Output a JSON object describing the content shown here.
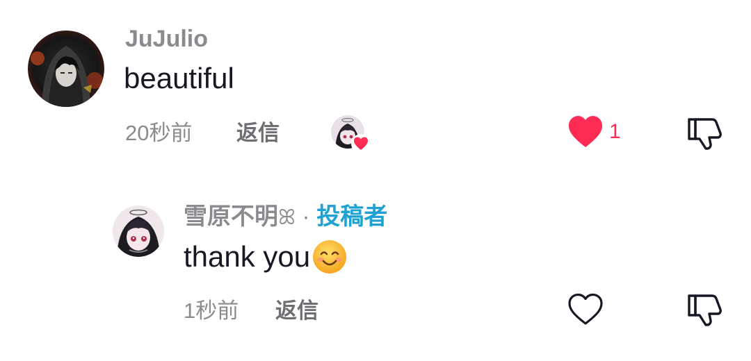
{
  "comments": [
    {
      "username": "JuJulio",
      "text": "beautiful",
      "timestamp": "20秒前",
      "reply_label": "返信",
      "liked_by_creator": true,
      "liked": true,
      "like_count": "1",
      "avatar_icon": "hooded-figure-avatar",
      "like_color": "#fe2c55"
    },
    {
      "username": "雪原不明",
      "username_suffix": "ꕤ",
      "separator": "·",
      "author_tag": "投稿者",
      "text": "thank you",
      "emoji": "smiling-face-emoji",
      "timestamp": "1秒前",
      "reply_label": "返信",
      "liked": false,
      "avatar_icon": "anime-character-avatar",
      "author_tag_color": "#1fa2d1"
    }
  ]
}
